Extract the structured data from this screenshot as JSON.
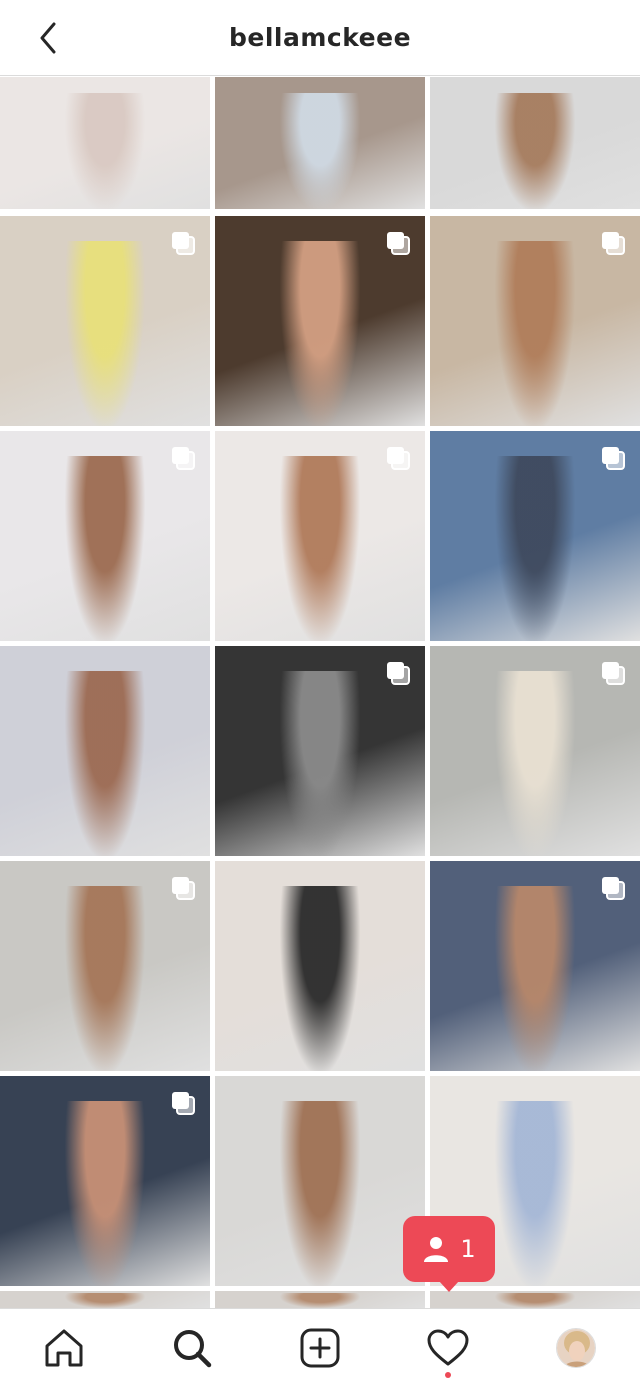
{
  "header": {
    "title": "bellamckeee",
    "back_icon": "chevron-left-icon"
  },
  "grid": {
    "rows": 6,
    "cols": 3,
    "tiles": [
      {
        "bg": "#ebe6e4",
        "fig": "#d9c9c2",
        "multi": false
      },
      {
        "bg": "#a7978c",
        "fig": "#cfd9e3",
        "multi": false
      },
      {
        "bg": "#d9d9d9",
        "fig": "#a67c5e",
        "multi": false
      },
      {
        "bg": "#d9d0c4",
        "fig": "#e8e07a",
        "multi": true
      },
      {
        "bg": "#4d3b2e",
        "fig": "#d39f82",
        "multi": true
      },
      {
        "bg": "#c8b7a3",
        "fig": "#b07d5a",
        "multi": true
      },
      {
        "bg": "#e9e7e9",
        "fig": "#9c6b50",
        "multi": true
      },
      {
        "bg": "#ece8e6",
        "fig": "#b07a5a",
        "multi": true
      },
      {
        "bg": "#5f7da3",
        "fig": "#3f4a5e",
        "multi": true
      },
      {
        "bg": "#cfd0d8",
        "fig": "#9c6a52",
        "multi": false
      },
      {
        "bg": "#353535",
        "fig": "#8a8a8a",
        "multi": true
      },
      {
        "bg": "#b6b7b3",
        "fig": "#e8e0d2",
        "multi": true
      },
      {
        "bg": "#c9c8c4",
        "fig": "#a57658",
        "multi": true
      },
      {
        "bg": "#e4ded9",
        "fig": "#2a2a2a",
        "multi": false
      },
      {
        "bg": "#52607a",
        "fig": "#b7876a",
        "multi": true
      },
      {
        "bg": "#374254",
        "fig": "#c79076",
        "multi": true
      },
      {
        "bg": "#d9d8d6",
        "fig": "#9f7154",
        "multi": false
      },
      {
        "bg": "#e9e6e2",
        "fig": "#a5b7d6",
        "multi": false
      }
    ]
  },
  "notification": {
    "icon": "person-icon",
    "count": "1",
    "color": "#ed4956"
  },
  "tabbar": {
    "tabs": [
      {
        "name": "home",
        "icon": "home-icon"
      },
      {
        "name": "search",
        "icon": "search-icon"
      },
      {
        "name": "new-post",
        "icon": "plus-square-icon"
      },
      {
        "name": "activity",
        "icon": "heart-icon"
      },
      {
        "name": "profile",
        "icon": "profile-avatar-icon"
      }
    ]
  }
}
